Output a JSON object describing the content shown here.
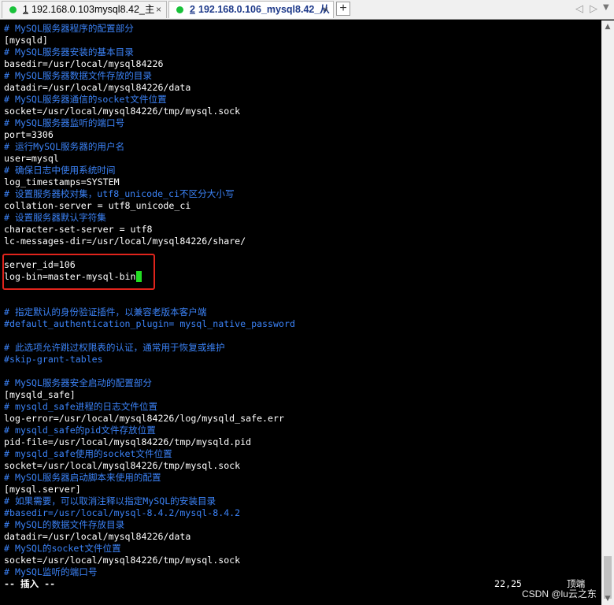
{
  "tabs": [
    {
      "number": "1",
      "title": "192.168.0.103mysql8.42_主",
      "close": "×"
    },
    {
      "number": "2",
      "title": "192.168.0.106_mysql8.42_从",
      "close": "×"
    }
  ],
  "tabbar": {
    "add": "+",
    "nav_left": "◁",
    "nav_right": "▷",
    "menu": "▼"
  },
  "colors": {
    "comment": "#3b82f6",
    "text": "#ffffff",
    "cursor": "#22dd22",
    "highlight": "#e0241c",
    "status_dot": "#19c23a"
  },
  "lines": [
    {
      "text": "# MySQL服务器程序的配置部分",
      "comment": true
    },
    {
      "text": "[mysqld]",
      "comment": false
    },
    {
      "text": "# MySQL服务器安装的基本目录",
      "comment": true
    },
    {
      "text": "basedir=/usr/local/mysql84226",
      "comment": false
    },
    {
      "text": "# MySQL服务器数据文件存放的目录",
      "comment": true
    },
    {
      "text": "datadir=/usr/local/mysql84226/data",
      "comment": false
    },
    {
      "text": "# MySQL服务器通信的socket文件位置",
      "comment": true
    },
    {
      "text": "socket=/usr/local/mysql84226/tmp/mysql.sock",
      "comment": false
    },
    {
      "text": "# MySQL服务器监听的端口号",
      "comment": true
    },
    {
      "text": "port=3306",
      "comment": false
    },
    {
      "text": "# 运行MySQL服务器的用户名",
      "comment": true
    },
    {
      "text": "user=mysql",
      "comment": false
    },
    {
      "text": "# 确保日志中使用系统时间",
      "comment": true
    },
    {
      "text": "log_timestamps=SYSTEM",
      "comment": false
    },
    {
      "text": "# 设置服务器校对集，utf8_unicode_ci不区分大小写",
      "comment": true
    },
    {
      "text": "collation-server = utf8_unicode_ci",
      "comment": false
    },
    {
      "text": "# 设置服务器默认字符集",
      "comment": true
    },
    {
      "text": "character-set-server = utf8",
      "comment": false
    },
    {
      "text": "lc-messages-dir=/usr/local/mysql84226/share/",
      "comment": false
    },
    {
      "text": "",
      "comment": false
    },
    {
      "text": "server_id=106",
      "comment": false
    },
    {
      "text": "log-bin=master-mysql-bin",
      "comment": false,
      "cursor": true
    },
    {
      "text": "",
      "comment": false
    },
    {
      "text": "",
      "comment": false
    },
    {
      "text": "# 指定默认的身份验证插件，以兼容老版本客户端",
      "comment": true
    },
    {
      "text": "#default_authentication_plugin= mysql_native_password",
      "comment": true
    },
    {
      "text": "",
      "comment": false
    },
    {
      "text": "# 此选项允许跳过权限表的认证，通常用于恢复或维护",
      "comment": true
    },
    {
      "text": "#skip-grant-tables",
      "comment": true
    },
    {
      "text": "",
      "comment": false
    },
    {
      "text": "# MySQL服务器安全启动的配置部分",
      "comment": true
    },
    {
      "text": "[mysqld_safe]",
      "comment": false
    },
    {
      "text": "# mysqld_safe进程的日志文件位置",
      "comment": true
    },
    {
      "text": "log-error=/usr/local/mysql84226/log/mysqld_safe.err",
      "comment": false
    },
    {
      "text": "# mysqld_safe的pid文件存放位置",
      "comment": true
    },
    {
      "text": "pid-file=/usr/local/mysql84226/tmp/mysqld.pid",
      "comment": false
    },
    {
      "text": "# mysqld_safe使用的socket文件位置",
      "comment": true
    },
    {
      "text": "socket=/usr/local/mysql84226/tmp/mysql.sock",
      "comment": false
    },
    {
      "text": "# MySQL服务器启动脚本来使用的配置",
      "comment": true
    },
    {
      "text": "[mysql.server]",
      "comment": false
    },
    {
      "text": "# 如果需要，可以取消注释以指定MySQL的安装目录",
      "comment": true
    },
    {
      "text": "#basedir=/usr/local/mysql-8.4.2/mysql-8.4.2",
      "comment": true
    },
    {
      "text": "# MySQL的数据文件存放目录",
      "comment": true
    },
    {
      "text": "datadir=/usr/local/mysql84226/data",
      "comment": false
    },
    {
      "text": "# MySQL的socket文件位置",
      "comment": true
    },
    {
      "text": "socket=/usr/local/mysql84226/tmp/mysql.sock",
      "comment": false
    },
    {
      "text": "# MySQL监听的端口号",
      "comment": true
    }
  ],
  "status": {
    "mode": "-- 插入 --",
    "position": "22,25",
    "where": "顶端"
  },
  "watermark": "CSDN @lu云之东",
  "scrollbar": {
    "up": "▲",
    "down": "▼"
  }
}
